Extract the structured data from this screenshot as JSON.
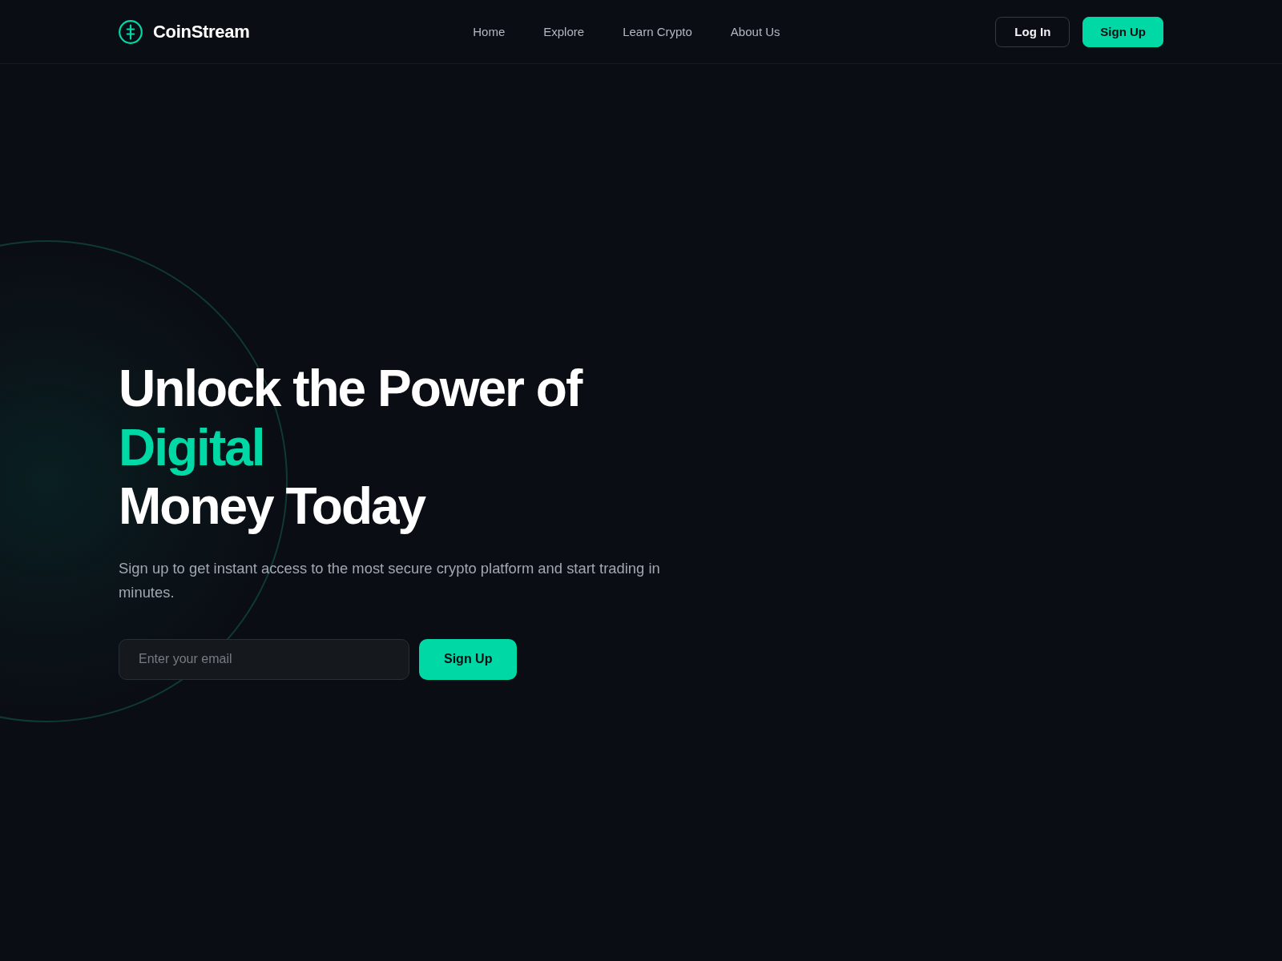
{
  "header": {
    "brand": "CoinStream",
    "nav": [
      {
        "label": "Home"
      },
      {
        "label": "Explore"
      },
      {
        "label": "Learn Crypto"
      },
      {
        "label": "About Us"
      }
    ],
    "buttons": [
      {
        "label": "Log In",
        "kind": "outline"
      },
      {
        "label": "Sign Up",
        "kind": "primary"
      }
    ]
  },
  "hero": {
    "heading": [
      {
        "text": "Unlock the Power of",
        "accent": false
      },
      {
        "text": "Digital",
        "accent": true
      },
      {
        "text": "Money Today",
        "accent": false
      }
    ],
    "subtitle": "Sign up to get instant access to the most secure crypto platform and start trading in minutes.",
    "signup_form": {
      "email": {
        "placeholder": "Enter your email"
      },
      "button": "Sign Up"
    }
  }
}
